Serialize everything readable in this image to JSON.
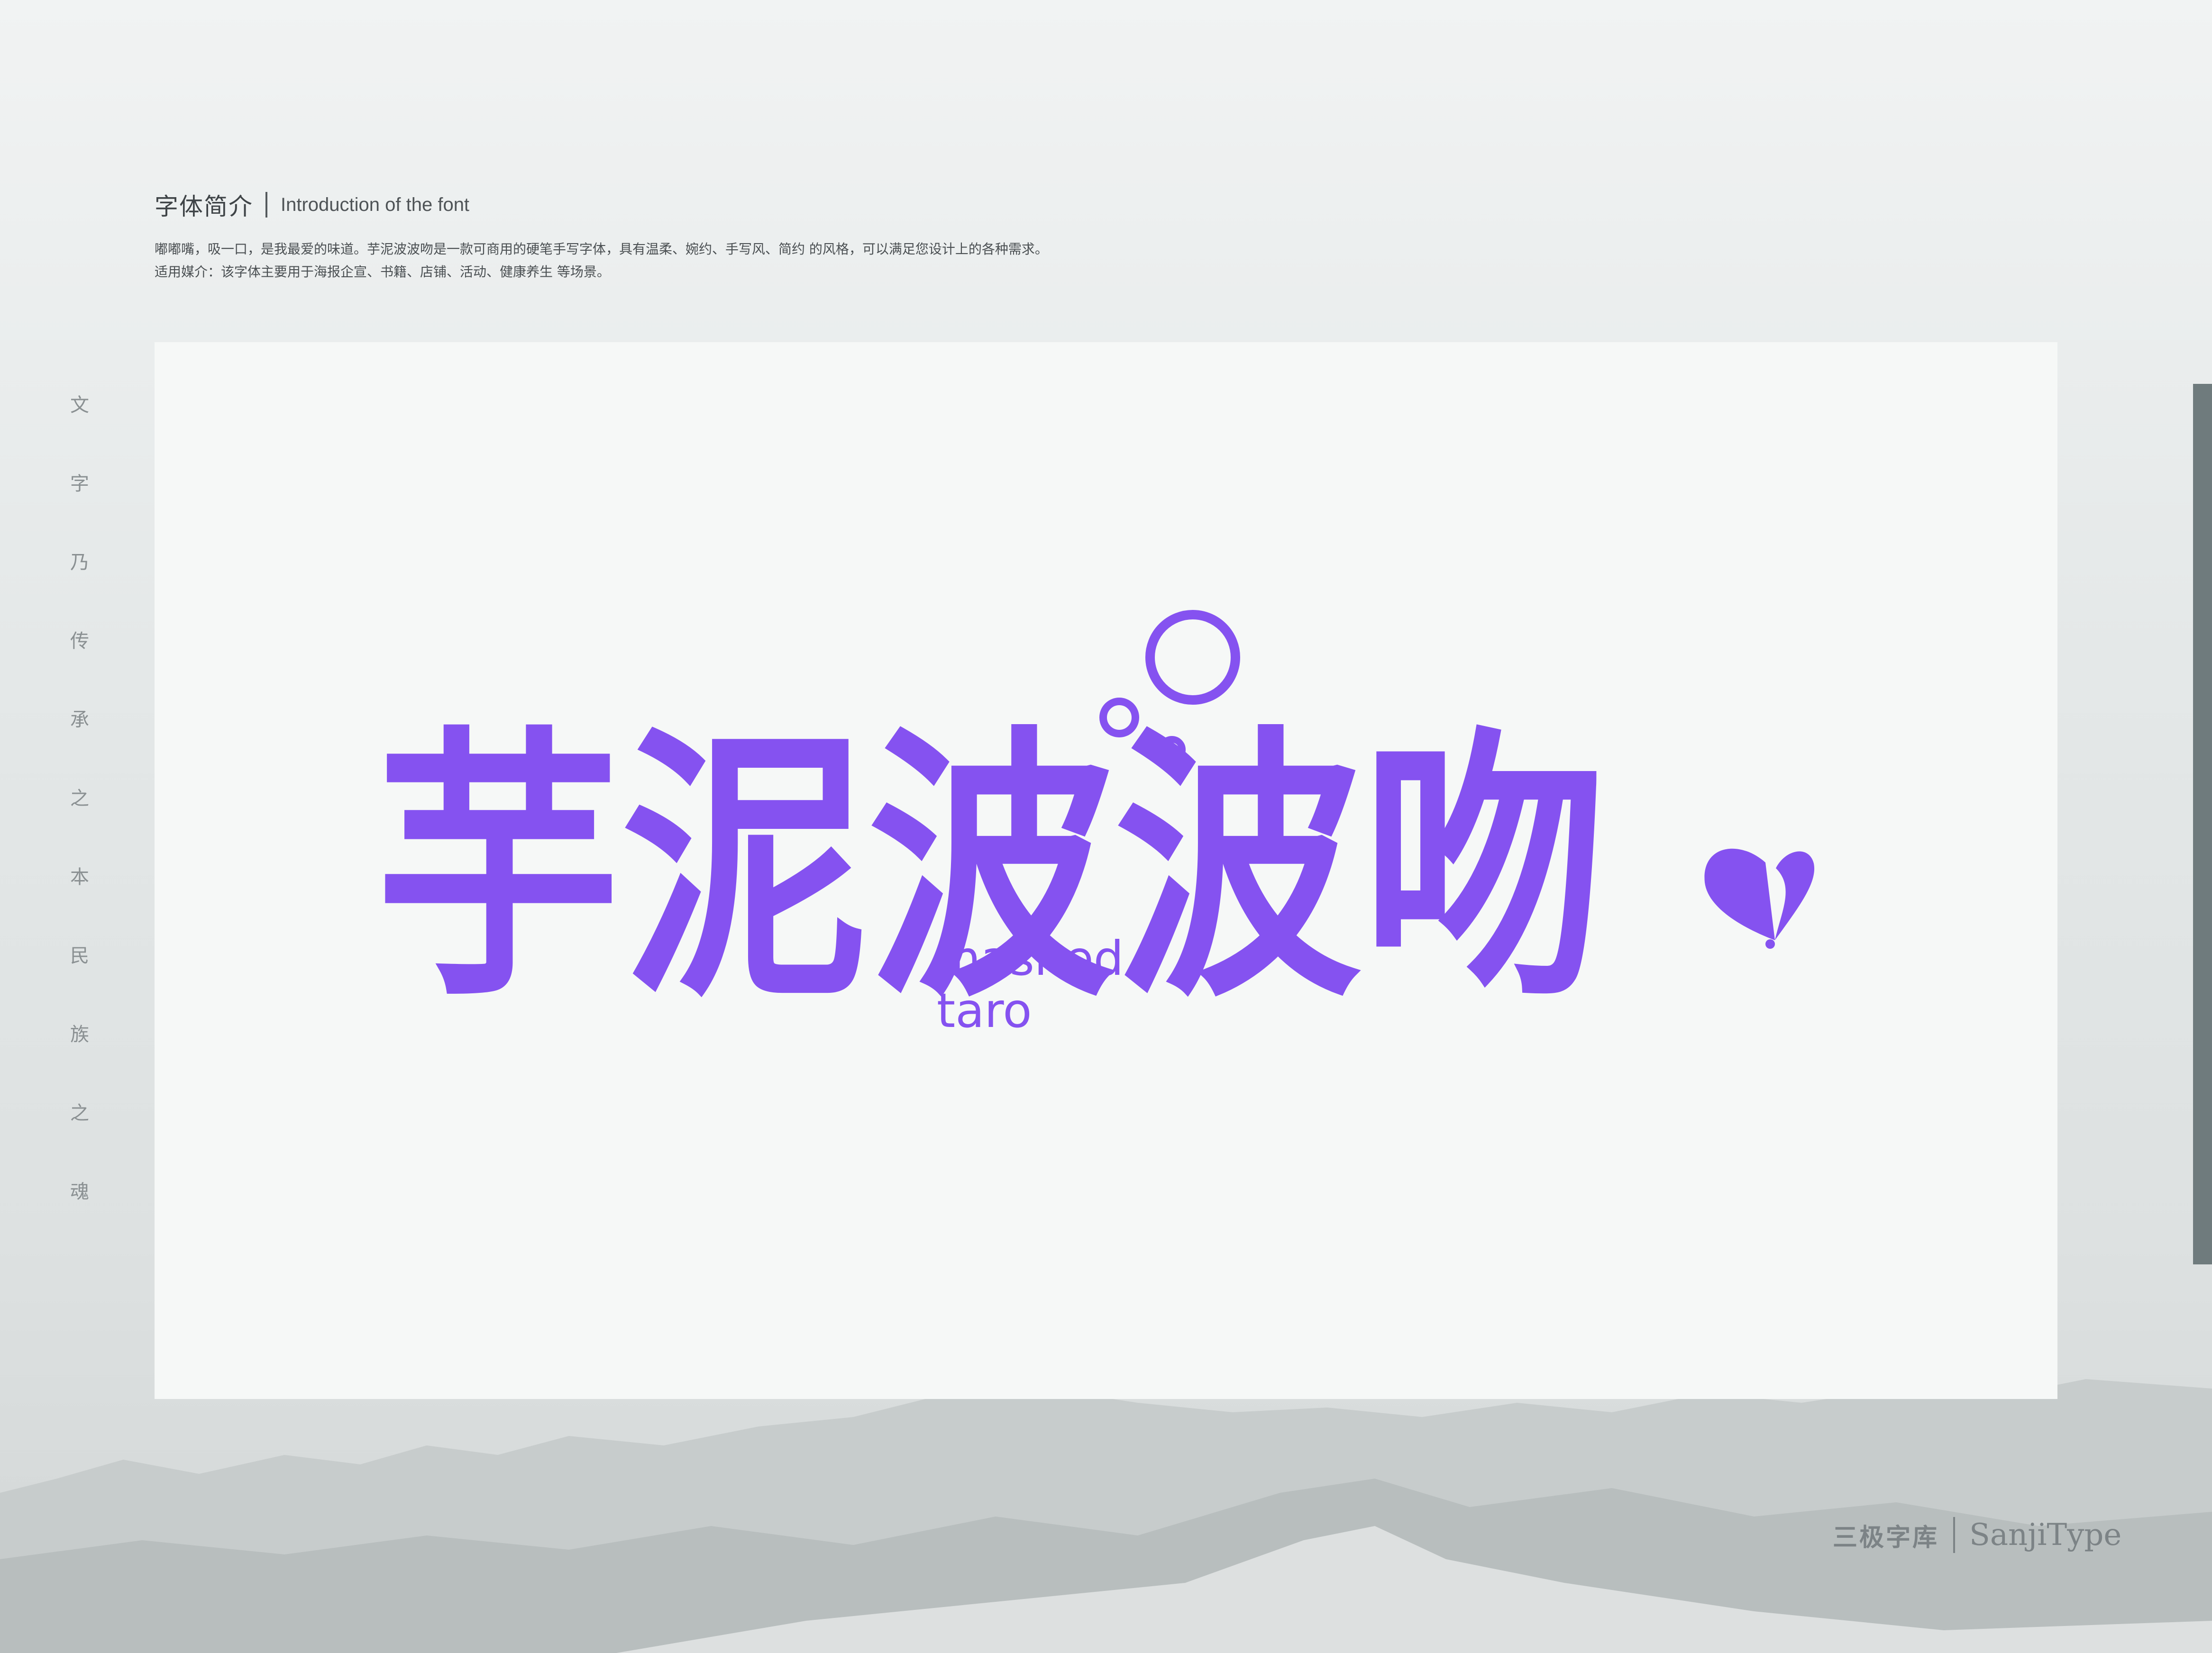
{
  "header": {
    "title_cn": "字体简介",
    "title_en": "Introduction of the font",
    "desc_line1": "嘟嘟嘴，吸一口，是我最爱的味道。芋泥波波吻是一款可商用的硬笔手写字体，具有温柔、婉约、手写风、简约 的风格，可以满足您设计上的各种需求。",
    "desc_line2": "适用媒介：该字体主要用于海报企宣、书籍、店铺、活动、健康养生 等场景。"
  },
  "vertical_text": [
    "文",
    "字",
    "乃",
    "传",
    "承",
    "之",
    "本",
    "民",
    "族",
    "之",
    "魂"
  ],
  "artwork": {
    "title": "芋泥波波吻",
    "subtitle_line1": "mashed",
    "subtitle_line2": "taro",
    "color": "#8552f0"
  },
  "brand": {
    "name_cn": "三极字库",
    "name_en": "SanjiType"
  },
  "colors": {
    "accent": "#8552f0",
    "side_bar": "#6f7b7d",
    "card": "#f6f8f7"
  }
}
